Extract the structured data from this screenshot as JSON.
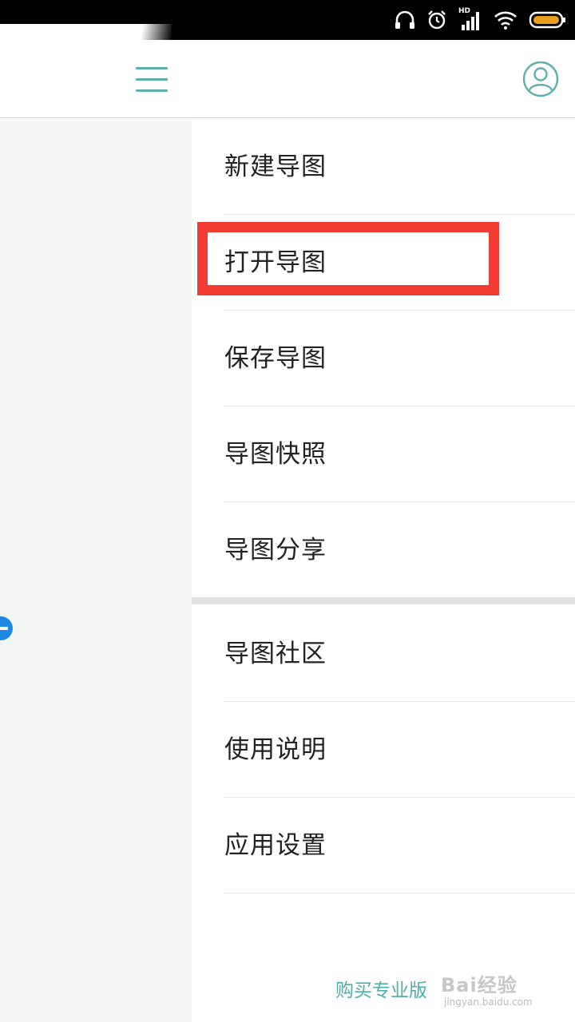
{
  "status_bar": {
    "hd_label": "HD",
    "icons": [
      "headphones-icon",
      "alarm-icon",
      "signal-icon",
      "wifi-icon",
      "battery-icon"
    ],
    "battery_color": "#e6a01e"
  },
  "header": {
    "menu_icon": "hamburger-menu-icon",
    "profile_icon": "user-profile-icon",
    "accent_color": "#5fb0ad"
  },
  "menu": {
    "items": [
      {
        "label": "新建导图"
      },
      {
        "label": "打开导图"
      },
      {
        "label": "保存导图"
      },
      {
        "label": "导图快照"
      },
      {
        "label": "导图分享"
      },
      {
        "label": "导图社区"
      },
      {
        "label": "使用说明"
      },
      {
        "label": "应用设置"
      }
    ],
    "highlighted_item": "打开导图",
    "highlight_color": "#f33a33"
  },
  "footer": {
    "buy_pro_label": "购买专业版"
  },
  "watermark": {
    "main": "Bai经验",
    "sub": "jingyan.baidu.com"
  }
}
